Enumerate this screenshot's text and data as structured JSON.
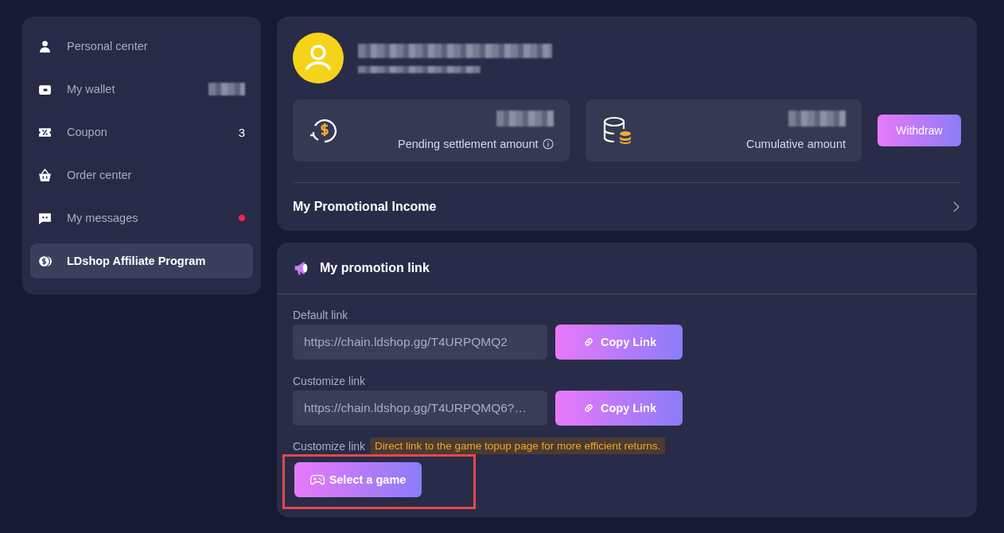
{
  "sidebar": {
    "items": [
      {
        "label": "Personal center",
        "selected": false,
        "kind": "plain"
      },
      {
        "label": "My wallet",
        "selected": false,
        "kind": "masked"
      },
      {
        "label": "Coupon",
        "selected": false,
        "kind": "count",
        "count": "3"
      },
      {
        "label": "Order center",
        "selected": false,
        "kind": "plain"
      },
      {
        "label": "My messages",
        "selected": false,
        "kind": "dot",
        "unread": true
      },
      {
        "label": "LDshop Affiliate Program",
        "selected": true,
        "kind": "plain"
      }
    ]
  },
  "profile": {
    "stats": [
      {
        "label": "Pending settlement amount",
        "info": true
      },
      {
        "label": "Cumulative amount",
        "info": false
      }
    ],
    "withdraw_button": "Withdraw",
    "income_link": "My Promotional Income"
  },
  "promotion": {
    "title": "My promotion link",
    "links": [
      {
        "label": "Default link",
        "value": "https://chain.ldshop.gg/T4URPQMQ2",
        "button": "Copy Link"
      },
      {
        "label": "Customize link",
        "value": "https://chain.ldshop.gg/T4URPQMQ6?…",
        "button": "Copy Link"
      }
    ],
    "game_label": "Customize link",
    "tip": "Direct link to the game topup page for more efficient returns.",
    "game_button": "Select a game",
    "highlighted": true
  }
}
